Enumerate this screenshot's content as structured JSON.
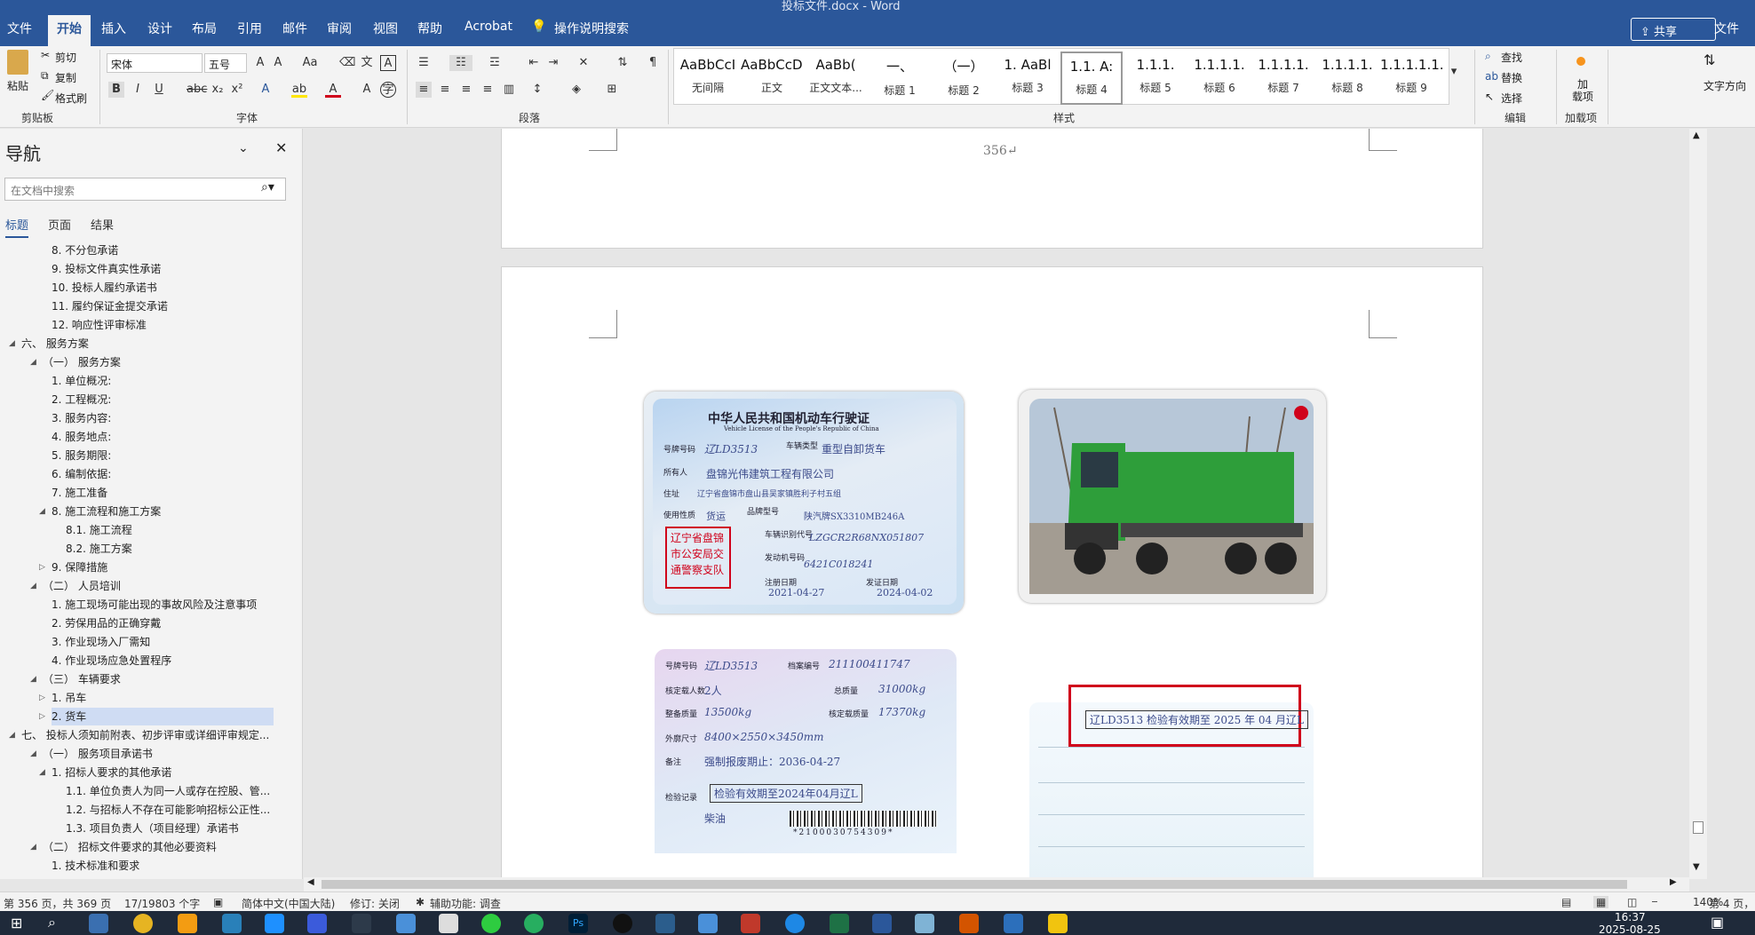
{
  "window": {
    "title": "投标文件.docx - Word"
  },
  "tabs": [
    "文件",
    "开始",
    "插入",
    "设计",
    "布局",
    "引用",
    "邮件",
    "审阅",
    "视图",
    "帮助",
    "Acrobat",
    "操作说明搜索"
  ],
  "share_label": "共享",
  "right_file_label": "文件",
  "clipboard": {
    "paste": "粘贴",
    "cut": "剪切",
    "copy": "复制",
    "format_painter": "格式刷",
    "label": "剪贴板"
  },
  "font": {
    "name": "宋体",
    "size": "五号",
    "label": "字体"
  },
  "paragraph": {
    "label": "段落"
  },
  "styles": {
    "label": "样式",
    "items": [
      {
        "sample": "AaBbCcI",
        "name": "无间隔"
      },
      {
        "sample": "AaBbCcDdI",
        "name": "正文"
      },
      {
        "sample": "AaBb(",
        "name": "正文文本..."
      },
      {
        "sample": "一、",
        "name": "标题 1"
      },
      {
        "sample": "（一）",
        "name": "标题 2"
      },
      {
        "sample": "1.   AaBl",
        "name": "标题 3"
      },
      {
        "sample": "1.1.  A:",
        "name": "标题 4"
      },
      {
        "sample": "1.1.1.",
        "name": "标题 5"
      },
      {
        "sample": "1.1.1.1.",
        "name": "标题 6"
      },
      {
        "sample": "1.1.1.1.",
        "name": "标题 7"
      },
      {
        "sample": "1.1.1.1.",
        "name": "标题 8"
      },
      {
        "sample": "1.1.1.1.1.",
        "name": "标题 9"
      }
    ]
  },
  "editing": {
    "find": "查找",
    "replace": "替换",
    "select": "选择",
    "label": "编辑"
  },
  "addins": {
    "add": "加\n载项",
    "label": "加载项"
  },
  "text_direction": "文字方向",
  "nav": {
    "title": "导航",
    "search_placeholder": "在文档中搜索",
    "tabs": [
      "标题",
      "页面",
      "结果"
    ],
    "items": [
      {
        "text": "8. 不分包承诺",
        "level": 3
      },
      {
        "text": "9. 投标文件真实性承诺",
        "level": 3
      },
      {
        "text": "10. 投标人履约承诺书",
        "level": 3
      },
      {
        "text": "11. 履约保证金提交承诺",
        "level": 3
      },
      {
        "text": "12. 响应性评审标准",
        "level": 3
      },
      {
        "text": "六、 服务方案",
        "level": 1,
        "expanded": true
      },
      {
        "text": "（一） 服务方案",
        "level": 2,
        "expanded": true
      },
      {
        "text": "1. 单位概况:",
        "level": 3
      },
      {
        "text": "2. 工程概况:",
        "level": 3
      },
      {
        "text": "3. 服务内容:",
        "level": 3
      },
      {
        "text": "4. 服务地点:",
        "level": 3
      },
      {
        "text": "5. 服务期限:",
        "level": 3
      },
      {
        "text": "6. 编制依据:",
        "level": 3
      },
      {
        "text": "7. 施工准备",
        "level": 3
      },
      {
        "text": "8. 施工流程和施工方案",
        "level": 3,
        "expanded": true
      },
      {
        "text": "8.1. 施工流程",
        "level": 4
      },
      {
        "text": "8.2. 施工方案",
        "level": 4
      },
      {
        "text": "9. 保障措施",
        "level": 3,
        "collapsed": true
      },
      {
        "text": "（二） 人员培训",
        "level": 2,
        "expanded": true
      },
      {
        "text": "1. 施工现场可能出现的事故风险及注意事项",
        "level": 3
      },
      {
        "text": "2. 劳保用品的正确穿戴",
        "level": 3
      },
      {
        "text": "3. 作业现场入厂需知",
        "level": 3
      },
      {
        "text": "4. 作业现场应急处置程序",
        "level": 3
      },
      {
        "text": "（三） 车辆要求",
        "level": 2,
        "expanded": true
      },
      {
        "text": "1. 吊车",
        "level": 3,
        "collapsed": true
      },
      {
        "text": "2. 货车",
        "level": 3,
        "collapsed": true,
        "selected": true
      },
      {
        "text": "七、 投标人须知前附表、初步评审或详细评审规定...",
        "level": 1,
        "expanded": true
      },
      {
        "text": "（一） 服务项目承诺书",
        "level": 2,
        "expanded": true
      },
      {
        "text": "1. 招标人要求的其他承诺",
        "level": 3,
        "expanded": true
      },
      {
        "text": "1.1. 单位负责人为同一人或存在控股、管...",
        "level": 4
      },
      {
        "text": "1.2. 与招标人不存在可能影响招标公正性...",
        "level": 4
      },
      {
        "text": "1.3. 项目负责人（项目经理）承诺书",
        "level": 4
      },
      {
        "text": "（二） 招标文件要求的其他必要资料",
        "level": 2,
        "expanded": true
      },
      {
        "text": "1. 技术标准和要求",
        "level": 3
      }
    ]
  },
  "document": {
    "page_number_text": "356↵",
    "license": {
      "title": "中华人民共和国机动车行驶证",
      "subtitle": "Vehicle License of the People's Republic of China",
      "plate_label": "号牌号码",
      "plate": "辽LD3513",
      "type_label": "车辆类型",
      "type": "重型自卸货车",
      "owner_label": "所有人",
      "owner": "盘锦光伟建筑工程有限公司",
      "address_label": "住址",
      "address": "辽宁省盘锦市盘山县吴家镇胜利子村五组",
      "use_label": "使用性质",
      "use": "货运",
      "model_label": "品牌型号",
      "model": "陕汽牌SX3310MB246A",
      "vin_label": "车辆识别代号",
      "vin": "LZGCR2R68NX051807",
      "engine_label": "发动机号码",
      "engine": "6421C018241",
      "reg_label": "注册日期",
      "reg": "2021-04-27",
      "issue_label": "发证日期",
      "issue": "2024-04-02",
      "stamp": "辽宁省盘锦市公安局交通警察支队"
    },
    "license_back": {
      "plate": "辽LD3513",
      "file_no_label": "档案编号",
      "file_no": "211100411747",
      "persons_label": "核定载人数",
      "persons": "2人",
      "total_mass_label": "总质量",
      "total_mass": "31000kg",
      "curb_label": "整备质量",
      "curb": "13500kg",
      "load_label": "核定载质量",
      "load": "17370kg",
      "dims_label": "外廓尺寸",
      "dims": "8400×2550×3450mm",
      "note_label": "备注",
      "note": "强制报废期止：2036-04-27",
      "inspect_label": "检验记录",
      "inspect": "检验有效期至2024年04月辽L",
      "fuel": "柴油",
      "barcode": "*2100030754309*"
    },
    "inspection_stamp": "辽LD3513 检验有效期至 2025 年 04 月辽L"
  },
  "status": {
    "page": "第 356 页，共 369 页",
    "words": "17/19803 个字",
    "language": "简体中文(中国大陆)",
    "track_changes": "修订: 关闭",
    "accessibility": "辅助功能: 调查",
    "zoom": "140%",
    "right": "第 4 页，"
  },
  "clock": {
    "time": "16:37",
    "date": "2025-08-25"
  },
  "colors": {
    "brand": "#2b579a",
    "highlight_box": "#d0021b",
    "truck": "#2e9e3a"
  }
}
